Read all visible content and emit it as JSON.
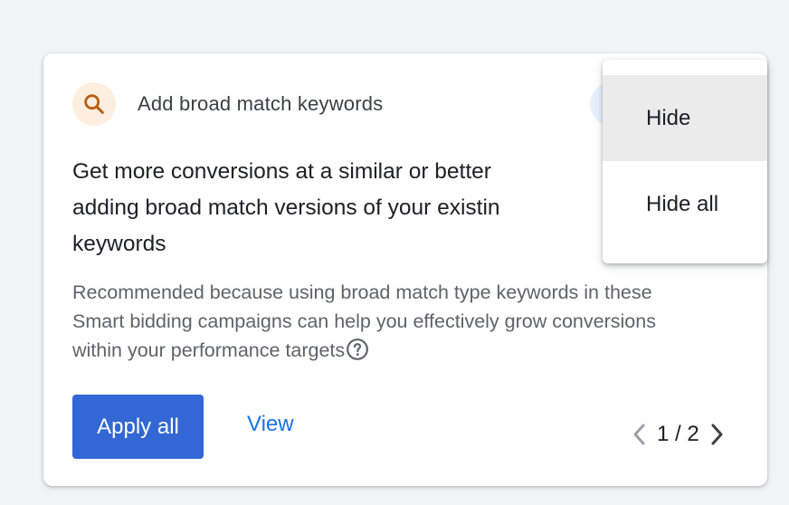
{
  "recommendation": {
    "type_label": "Add broad match keywords",
    "headline": "Get more conversions at a similar or better ROAS by adding broad match versions of your existing keywords",
    "headline_visible_line1": "Get more conversions at a similar or better",
    "headline_visible_line2": "adding broad match versions of your existin",
    "headline_visible_line3": "keywords",
    "description": "Recommended because using broad match type keywords in these Smart bidding campaigns can help you effectively grow conversions within your performance targets",
    "icon": "search-icon",
    "help_icon": "help-circle-icon"
  },
  "actions": {
    "apply_label": "Apply all",
    "view_label": "View"
  },
  "pagination": {
    "text": "1 / 2",
    "prev_icon": "chevron-left-icon",
    "next_icon": "chevron-right-icon"
  },
  "menu": {
    "items": [
      {
        "label": "Hide",
        "highlighted": true
      },
      {
        "label": "Hide all",
        "highlighted": false
      }
    ]
  },
  "colors": {
    "primary_button": "#3367d6",
    "link": "#1a73e8",
    "icon_bg": "#fdeee0",
    "icon_fg": "#b95e0f"
  }
}
